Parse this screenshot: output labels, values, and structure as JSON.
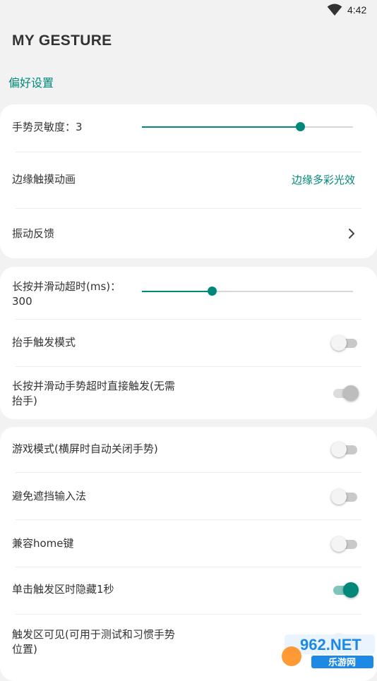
{
  "status_bar": {
    "time": "4:42",
    "wifi_icon": "wifi-icon"
  },
  "app": {
    "title": "MY GESTURE"
  },
  "section": {
    "label": "偏好设置"
  },
  "card1": {
    "sensitivity": {
      "label": "手势灵敏度：3",
      "slider_fraction": 0.75
    },
    "edge_animation": {
      "label": "边缘触摸动画",
      "value": "边缘多彩光效"
    },
    "vibration": {
      "label": "振动反馈"
    }
  },
  "card2": {
    "long_press_timeout": {
      "label_line1": "长按并滑动超时(ms)：",
      "label_line2": "300",
      "slider_fraction": 0.33
    },
    "lift_trigger": {
      "label": "抬手触发模式",
      "state": "off"
    },
    "direct_trigger": {
      "label_line1": "长按并滑动手势超时直接触发(无需",
      "label_line2": "抬手)",
      "state": "disabled-on"
    }
  },
  "card3": {
    "game_mode": {
      "label": "游戏模式(横屏时自动关闭手势)",
      "state": "off"
    },
    "avoid_ime": {
      "label": "避免遮挡输入法",
      "state": "off"
    },
    "home_compat": {
      "label": "兼容home键",
      "state": "off"
    },
    "hide_on_tap": {
      "label": "单击触发区时隐藏1秒",
      "state": "on"
    },
    "visible_area": {
      "label_line1": "触发区可见(可用于测试和习惯手势",
      "label_line2": "位置)",
      "state": "off"
    }
  },
  "watermark": {
    "text_top": "962.NET",
    "text_bottom": "乐游网"
  },
  "colors": {
    "accent": "#00897b",
    "background": "#f2f2f2",
    "card": "#ffffff"
  }
}
